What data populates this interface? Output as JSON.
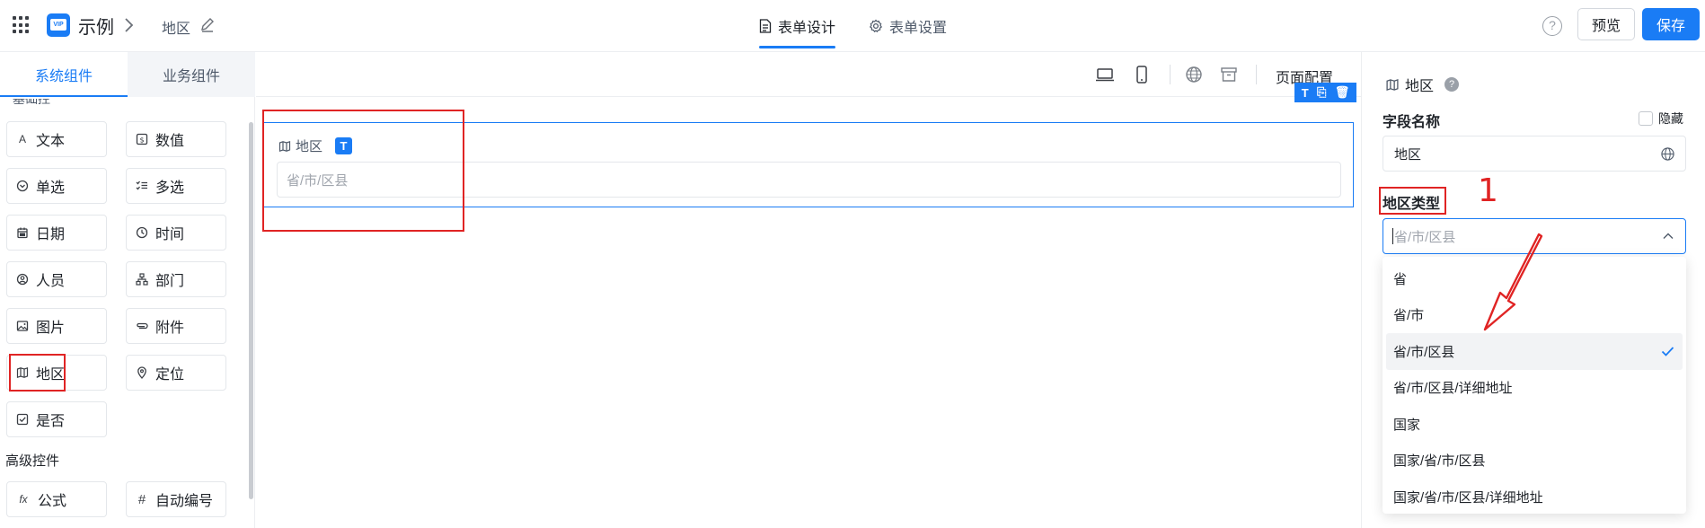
{
  "header": {
    "app_name": "示例",
    "form_title": "地区",
    "tabs": [
      {
        "label": "表单设计",
        "active": true
      },
      {
        "label": "表单设置",
        "active": false
      }
    ],
    "preview_label": "预览",
    "save_label": "保存",
    "help_glyph": "?",
    "logo_text": "VIP"
  },
  "left_panel": {
    "tabs": [
      {
        "label": "系统组件",
        "active": true
      },
      {
        "label": "业务组件",
        "active": false
      }
    ],
    "cut_off_label": "基础控件",
    "components": [
      {
        "label": "文本",
        "icon": "text-a-icon"
      },
      {
        "label": "数值",
        "icon": "number-icon"
      },
      {
        "label": "单选",
        "icon": "radio-icon"
      },
      {
        "label": "多选",
        "icon": "checklist-icon"
      },
      {
        "label": "日期",
        "icon": "calendar-icon"
      },
      {
        "label": "时间",
        "icon": "clock-icon"
      },
      {
        "label": "人员",
        "icon": "user-icon"
      },
      {
        "label": "部门",
        "icon": "org-icon"
      },
      {
        "label": "图片",
        "icon": "image-icon"
      },
      {
        "label": "附件",
        "icon": "paperclip-icon"
      },
      {
        "label": "地区",
        "icon": "map-icon"
      },
      {
        "label": "定位",
        "icon": "location-pin-icon"
      },
      {
        "label": "是否",
        "icon": "checkbox-icon"
      }
    ],
    "advanced_section_label": "高级控件",
    "advanced_components": [
      {
        "label": "公式",
        "icon": "fx-icon"
      },
      {
        "label": "自动编号",
        "icon": "hash-icon"
      }
    ]
  },
  "canvas": {
    "page_config_label": "页面配置",
    "field": {
      "label": "地区",
      "type_badge": "T",
      "placeholder": "省/市/区县",
      "tools": [
        "T",
        "⎘",
        "🗑"
      ]
    }
  },
  "right_panel": {
    "field_title": "地区",
    "help_glyph": "?",
    "field_name_label": "字段名称",
    "hide_label": "隐藏",
    "field_name_value": "地区",
    "region_type_label": "地区类型",
    "annotation_number": "1",
    "region_type_value": "省/市/区县",
    "options": [
      {
        "label": "省",
        "selected": false
      },
      {
        "label": "省/市",
        "selected": false
      },
      {
        "label": "省/市/区县",
        "selected": true
      },
      {
        "label": "省/市/区县/详细地址",
        "selected": false
      },
      {
        "label": "国家",
        "selected": false
      },
      {
        "label": "国家/省/市/区县",
        "selected": false
      },
      {
        "label": "国家/省/市/区县/详细地址",
        "selected": false
      }
    ]
  },
  "colors": {
    "accent": "#1a7cf5",
    "annotation_red": "#e02424"
  }
}
